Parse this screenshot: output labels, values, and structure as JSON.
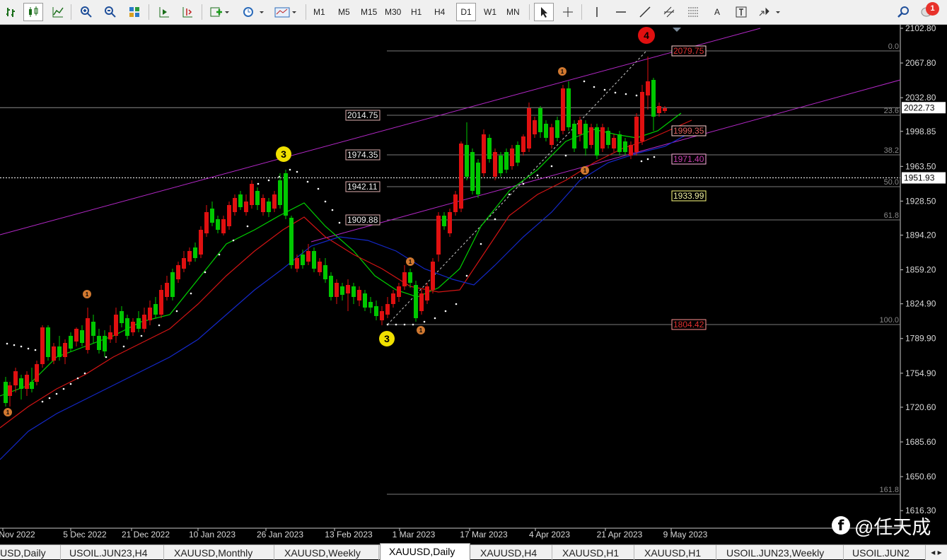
{
  "toolbar": {
    "timeframes": [
      "M1",
      "M5",
      "M15",
      "M30",
      "H1",
      "H4",
      "D1",
      "W1",
      "MN"
    ],
    "active_timeframe": "D1",
    "text_tool": "A",
    "notification_count": "1"
  },
  "chart": {
    "symbol": "XAUUSD",
    "timeframe": "Daily",
    "current_price": "2022.73",
    "crosshair_price": "1951.93",
    "price_scale": [
      "2102.80",
      "2067.80",
      "2032.80",
      "1998.85",
      "1963.50",
      "1928.50",
      "1894.20",
      "1859.20",
      "1824.90",
      "1789.90",
      "1754.90",
      "1720.60",
      "1685.60",
      "1650.60",
      "1616.30"
    ],
    "date_labels": [
      "Nov 2022",
      "5 Dec 2022",
      "21 Dec 2022",
      "10 Jan 2023",
      "26 Jan 2023",
      "13 Feb 2023",
      "1 Mar 2023",
      "17 Mar 2023",
      "4 Apr 2023",
      "21 Apr 2023",
      "9 May 2023"
    ],
    "fibonacci_levels": [
      "0.0",
      "23.6",
      "38.2",
      "50.0",
      "61.8",
      "100.0",
      "161.8"
    ],
    "level_tags_left": [
      "2014.75",
      "1974.35",
      "1942.11",
      "1909.88"
    ],
    "level_tags_right": [
      "2079.75",
      "1999.35",
      "1971.40",
      "1933.99",
      "1804.42"
    ],
    "wave_labels": [
      "3",
      "3",
      "4",
      "1",
      "1",
      "1",
      "1",
      "1",
      "1"
    ]
  },
  "colors": {
    "background": "#000000",
    "bull_candle": "#00c800",
    "bear_candle": "#e01010",
    "ma_fast": "#00d200",
    "ma_mid": "#d21414",
    "ma_slow": "#1428c8",
    "channel": "#b428c8",
    "fib_line": "#7a7a7a"
  },
  "tabs": [
    "USD,Daily",
    "USOIL.JUN23,H4",
    "XAUUSD,Monthly",
    "XAUUSD,Weekly",
    "XAUUSD,Daily",
    "XAUUSD,H4",
    "XAUUSD,H1",
    "XAUUSD,H1",
    "USOIL.JUN23,Weekly",
    "USOIL.JUN2"
  ],
  "active_tab": "XAUUSD,Daily",
  "watermark": "@任天成"
}
